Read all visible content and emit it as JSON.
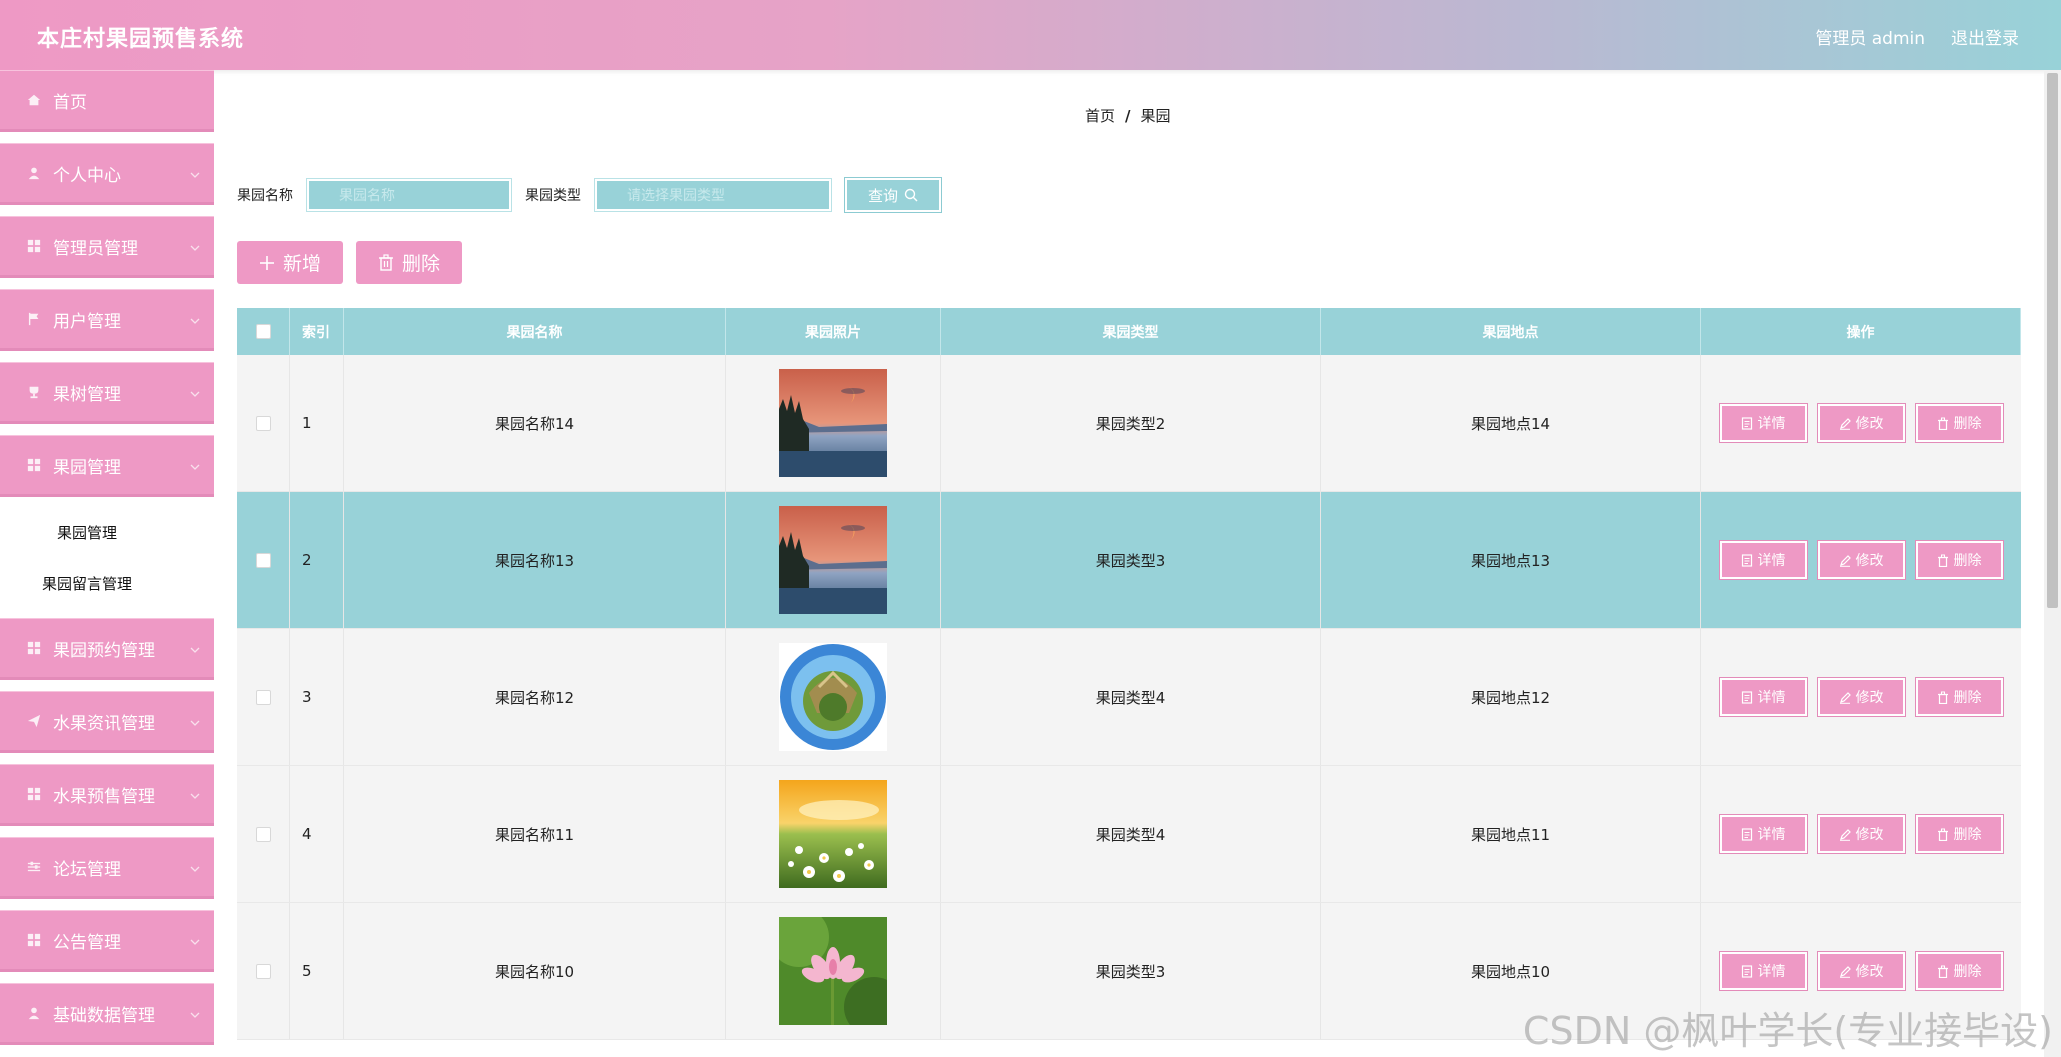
{
  "header": {
    "title": "本庄村果园预售系统",
    "admin_label": "管理员 admin",
    "logout_label": "退出登录"
  },
  "sidebar": {
    "items": [
      {
        "label": "首页",
        "icon": "home-icon"
      },
      {
        "label": "个人中心",
        "icon": "user-icon"
      },
      {
        "label": "管理员管理",
        "icon": "grid-icon"
      },
      {
        "label": "用户管理",
        "icon": "flag-icon"
      },
      {
        "label": "果树管理",
        "icon": "trophy-icon"
      },
      {
        "label": "果园管理",
        "icon": "grid-icon"
      }
    ],
    "submenu": [
      "果园管理",
      "果园留言管理"
    ],
    "items_after": [
      {
        "label": "果园预约管理",
        "icon": "grid-icon"
      },
      {
        "label": "水果资讯管理",
        "icon": "send-icon"
      },
      {
        "label": "水果预售管理",
        "icon": "grid-icon"
      },
      {
        "label": "论坛管理",
        "icon": "sliders-icon"
      },
      {
        "label": "公告管理",
        "icon": "grid-icon"
      },
      {
        "label": "基础数据管理",
        "icon": "user-icon"
      }
    ]
  },
  "breadcrumb": {
    "home": "首页",
    "sep": "/",
    "current": "果园"
  },
  "search": {
    "name_label": "果园名称",
    "name_placeholder": "果园名称",
    "type_label": "果园类型",
    "type_placeholder": "请选择果园类型",
    "query_label": "查询"
  },
  "actions": {
    "add_label": "新增",
    "delete_label": "删除"
  },
  "table": {
    "headers": [
      "索引",
      "果园名称",
      "果园照片",
      "果园类型",
      "果园地点",
      "操作"
    ],
    "rows": [
      {
        "index": "1",
        "name": "果园名称14",
        "type": "果园类型2",
        "location": "果园地点14",
        "photo": "lake-sunset"
      },
      {
        "index": "2",
        "name": "果园名称13",
        "type": "果园类型3",
        "location": "果园地点13",
        "photo": "lake-sunset"
      },
      {
        "index": "3",
        "name": "果园名称12",
        "type": "果园类型4",
        "location": "果园地点12",
        "photo": "tiny-planet"
      },
      {
        "index": "4",
        "name": "果园名称11",
        "type": "果园类型4",
        "location": "果园地点11",
        "photo": "flower-meadow"
      },
      {
        "index": "5",
        "name": "果园名称10",
        "type": "果园类型3",
        "location": "果园地点10",
        "photo": "lotus"
      }
    ],
    "op_detail": "详情",
    "op_edit": "修改",
    "op_delete": "删除"
  },
  "watermark": "CSDN @枫叶学长(专业接毕设)",
  "colors": {
    "pink": "#ee99c5",
    "teal": "#98d2d8"
  }
}
